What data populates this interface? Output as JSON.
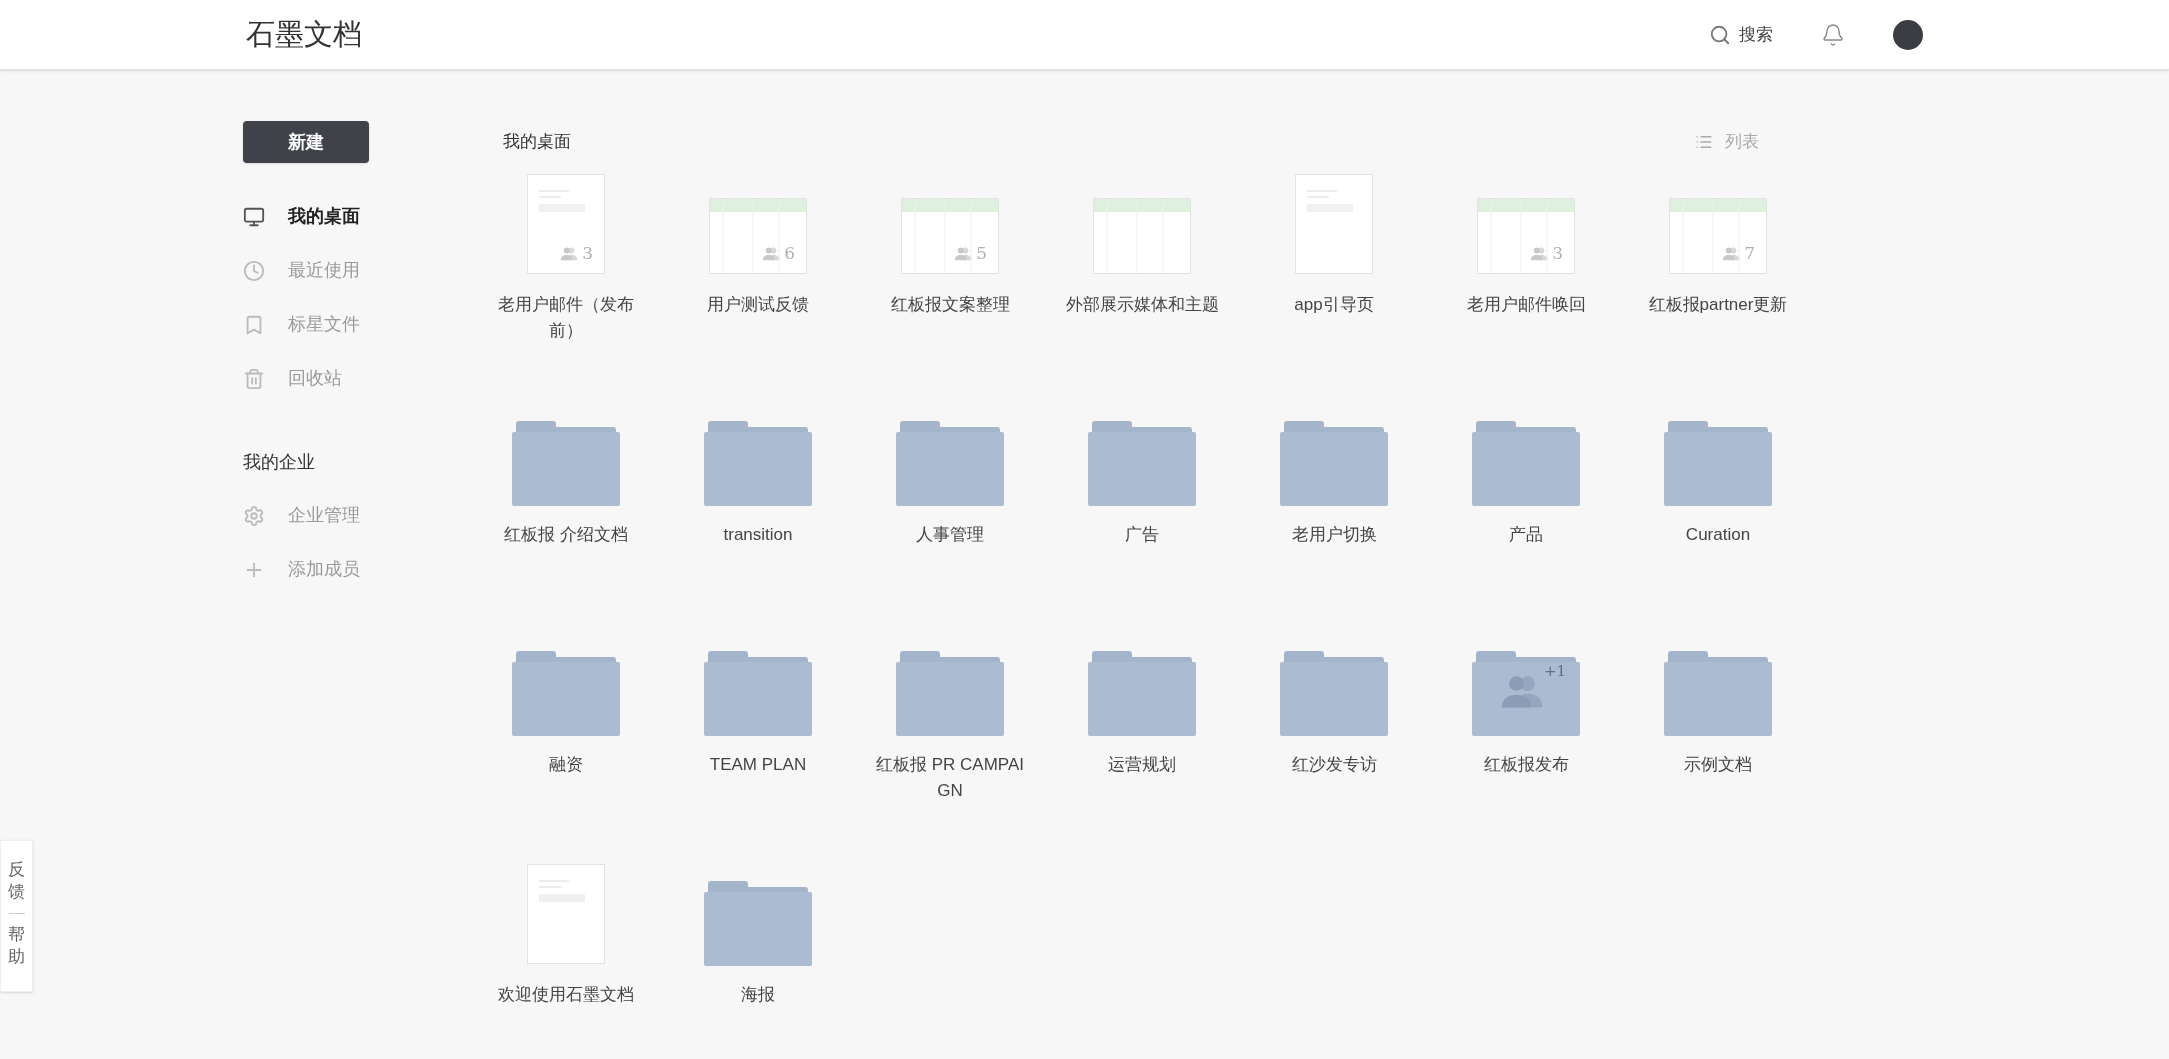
{
  "header": {
    "logo": "石墨文档",
    "search_label": "搜索"
  },
  "sidebar": {
    "new_button": "新建",
    "items": [
      {
        "label": "我的桌面",
        "selected": true
      },
      {
        "label": "最近使用",
        "selected": false
      },
      {
        "label": "标星文件",
        "selected": false
      },
      {
        "label": "回收站",
        "selected": false
      }
    ],
    "section_title": "我的企业",
    "enterprise_items": [
      {
        "label": "企业管理"
      },
      {
        "label": "添加成员"
      }
    ]
  },
  "breadcrumb": "我的桌面",
  "view_toggle": "列表",
  "files": [
    {
      "kind": "doc",
      "name": "老用户邮件（发布前）",
      "shared": "3"
    },
    {
      "kind": "sheet",
      "name": "用户测试反馈",
      "shared": "6"
    },
    {
      "kind": "sheet",
      "name": "红板报文案整理",
      "shared": "5"
    },
    {
      "kind": "sheet",
      "name": "外部展示媒体和主题"
    },
    {
      "kind": "doc",
      "name": "app引导页"
    },
    {
      "kind": "sheet",
      "name": "老用户邮件唤回",
      "shared": "3"
    },
    {
      "kind": "sheet",
      "name": "红板报partner更新",
      "shared": "7"
    },
    {
      "kind": "folder",
      "name": "红板报 介绍文档"
    },
    {
      "kind": "folder",
      "name": "transition"
    },
    {
      "kind": "folder",
      "name": "人事管理"
    },
    {
      "kind": "folder",
      "name": "广告"
    },
    {
      "kind": "folder",
      "name": "老用户切换"
    },
    {
      "kind": "folder",
      "name": "产品"
    },
    {
      "kind": "folder",
      "name": "Curation"
    },
    {
      "kind": "folder",
      "name": "融资"
    },
    {
      "kind": "folder",
      "name": "TEAM PLAN"
    },
    {
      "kind": "folder",
      "name": "红板报 PR CAMPAIGN"
    },
    {
      "kind": "folder",
      "name": "运营规划"
    },
    {
      "kind": "folder",
      "name": "红沙发专访"
    },
    {
      "kind": "folder",
      "name": "红板报发布",
      "shared": "+1"
    },
    {
      "kind": "folder",
      "name": "示例文档"
    },
    {
      "kind": "doc",
      "name": "欢迎使用石墨文档"
    },
    {
      "kind": "folder",
      "name": "海报"
    }
  ],
  "side_tab": {
    "feedback": "反馈",
    "help": "帮助"
  }
}
